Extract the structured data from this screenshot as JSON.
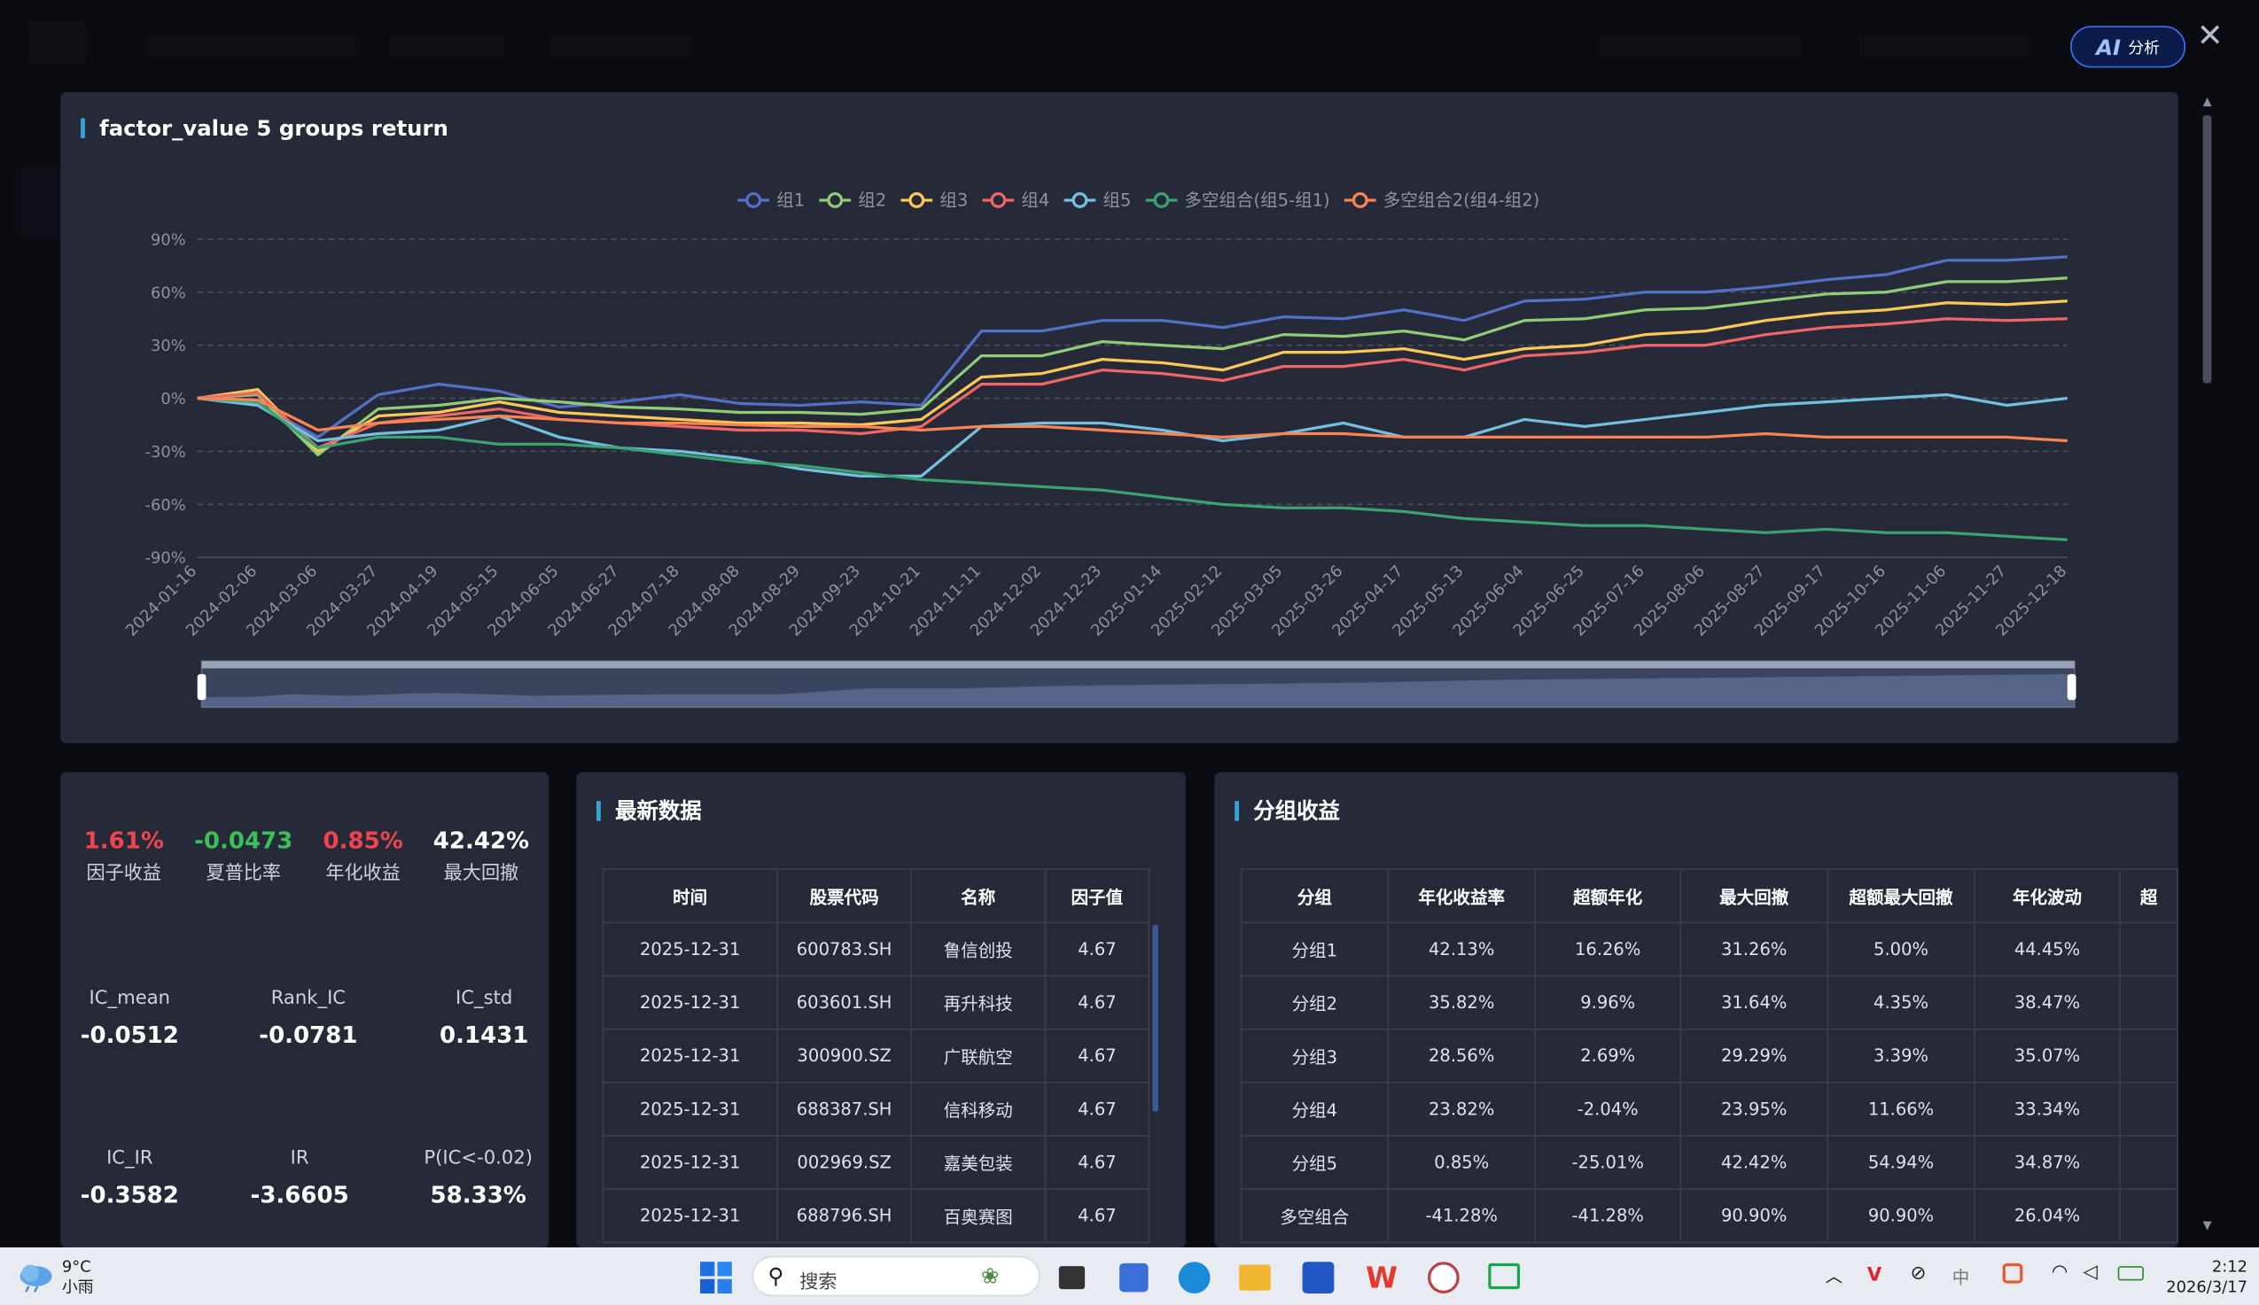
{
  "header": {
    "ai_label": "AI",
    "ai_text": "分析"
  },
  "chart_panel_title": "factor_value 5 groups return",
  "chart_data": {
    "type": "line",
    "title": "factor_value 5 groups return",
    "ylim": [
      -90,
      90
    ],
    "yticks": [
      "90%",
      "60%",
      "30%",
      "0%",
      "-30%",
      "-60%",
      "-90%"
    ],
    "grid": true,
    "legend_position": "top-center",
    "x_labels": [
      "2024-01-16",
      "2024-02-06",
      "2024-03-06",
      "2024-03-27",
      "2024-04-19",
      "2024-05-15",
      "2024-06-05",
      "2024-06-27",
      "2024-07-18",
      "2024-08-08",
      "2024-08-29",
      "2024-09-23",
      "2024-10-21",
      "2024-11-11",
      "2024-12-02",
      "2024-12-23",
      "2025-01-14",
      "2025-02-12",
      "2025-03-05",
      "2025-03-26",
      "2025-04-17",
      "2025-05-13",
      "2025-06-04",
      "2025-06-25",
      "2025-07-16",
      "2025-08-06",
      "2025-08-27",
      "2025-09-17",
      "2025-10-16",
      "2025-11-06",
      "2025-11-27",
      "2025-12-18"
    ],
    "series": [
      {
        "name": "组1",
        "color": "#5470c6",
        "values": [
          0,
          -3,
          -22,
          2,
          8,
          4,
          -5,
          -2,
          2,
          -3,
          -4,
          -2,
          -4,
          38,
          38,
          44,
          44,
          40,
          46,
          45,
          50,
          44,
          55,
          56,
          60,
          60,
          63,
          67,
          70,
          78,
          78,
          80
        ]
      },
      {
        "name": "组2",
        "color": "#91cc75",
        "values": [
          0,
          2,
          -32,
          -6,
          -4,
          0,
          -2,
          -5,
          -6,
          -8,
          -8,
          -9,
          -6,
          24,
          24,
          32,
          30,
          28,
          36,
          35,
          38,
          33,
          44,
          45,
          50,
          51,
          55,
          59,
          60,
          66,
          66,
          68
        ]
      },
      {
        "name": "组3",
        "color": "#fac858",
        "values": [
          0,
          5,
          -30,
          -10,
          -8,
          -2,
          -8,
          -10,
          -12,
          -14,
          -14,
          -15,
          -12,
          12,
          14,
          22,
          20,
          16,
          26,
          26,
          28,
          22,
          28,
          30,
          36,
          38,
          44,
          48,
          50,
          54,
          53,
          55
        ]
      },
      {
        "name": "组4",
        "color": "#ee6666",
        "values": [
          0,
          3,
          -28,
          -14,
          -10,
          -6,
          -12,
          -14,
          -16,
          -18,
          -18,
          -20,
          -16,
          8,
          8,
          16,
          14,
          10,
          18,
          18,
          22,
          16,
          24,
          26,
          30,
          30,
          36,
          40,
          42,
          45,
          44,
          45
        ]
      },
      {
        "name": "组5",
        "color": "#73c0de",
        "values": [
          0,
          -4,
          -24,
          -20,
          -18,
          -10,
          -22,
          -28,
          -30,
          -34,
          -40,
          -44,
          -44,
          -16,
          -14,
          -14,
          -18,
          -24,
          -20,
          -14,
          -22,
          -22,
          -12,
          -16,
          -12,
          -8,
          -4,
          -2,
          0,
          2,
          -4,
          0
        ]
      },
      {
        "name": "多空组合(组5-组1)",
        "color": "#3ba272",
        "values": [
          0,
          -2,
          -28,
          -22,
          -22,
          -26,
          -26,
          -28,
          -32,
          -36,
          -38,
          -42,
          -46,
          -48,
          -50,
          -52,
          -56,
          -60,
          -62,
          -62,
          -64,
          -68,
          -70,
          -72,
          -72,
          -74,
          -76,
          -74,
          -76,
          -76,
          -78,
          -80
        ]
      },
      {
        "name": "多空组合2(组4-组2)",
        "color": "#fc8452",
        "values": [
          0,
          -1,
          -18,
          -14,
          -12,
          -10,
          -12,
          -14,
          -14,
          -15,
          -16,
          -16,
          -18,
          -16,
          -16,
          -18,
          -20,
          -22,
          -20,
          -20,
          -22,
          -22,
          -22,
          -22,
          -22,
          -22,
          -20,
          -22,
          -22,
          -22,
          -22,
          -24
        ]
      }
    ]
  },
  "metrics": {
    "factor_return": {
      "value": "1.61%",
      "label": "因子收益"
    },
    "sharpe": {
      "value": "-0.0473",
      "label": "夏普比率"
    },
    "annual_return": {
      "value": "0.85%",
      "label": "年化收益"
    },
    "max_drawdown": {
      "value": "42.42%",
      "label": "最大回撤"
    },
    "ic_mean": {
      "value": "-0.0512",
      "label": "IC_mean"
    },
    "rank_ic": {
      "value": "-0.0781",
      "label": "Rank_IC"
    },
    "ic_std": {
      "value": "0.1431",
      "label": "IC_std"
    },
    "ic_ir": {
      "value": "-0.3582",
      "label": "IC_IR"
    },
    "ir": {
      "value": "-3.6605",
      "label": "IR"
    },
    "p_ic": {
      "value": "58.33%",
      "label": "P(IC<-0.02)"
    }
  },
  "latest": {
    "title": "最新数据",
    "columns": [
      "时间",
      "股票代码",
      "名称",
      "因子值"
    ],
    "rows": [
      [
        "2025-12-31",
        "600783.SH",
        "鲁信创投",
        "4.67"
      ],
      [
        "2025-12-31",
        "603601.SH",
        "再升科技",
        "4.67"
      ],
      [
        "2025-12-31",
        "300900.SZ",
        "广联航空",
        "4.67"
      ],
      [
        "2025-12-31",
        "688387.SH",
        "信科移动",
        "4.67"
      ],
      [
        "2025-12-31",
        "002969.SZ",
        "嘉美包装",
        "4.67"
      ],
      [
        "2025-12-31",
        "688796.SH",
        "百奥赛图",
        "4.67"
      ]
    ]
  },
  "groups": {
    "title": "分组收益",
    "columns": [
      "分组",
      "年化收益率",
      "超额年化",
      "最大回撤",
      "超额最大回撤",
      "年化波动",
      "超"
    ],
    "rows": [
      [
        "分组1",
        "42.13%",
        "16.26%",
        "31.26%",
        "5.00%",
        "44.45%",
        ""
      ],
      [
        "分组2",
        "35.82%",
        "9.96%",
        "31.64%",
        "4.35%",
        "38.47%",
        ""
      ],
      [
        "分组3",
        "28.56%",
        "2.69%",
        "29.29%",
        "3.39%",
        "35.07%",
        ""
      ],
      [
        "分组4",
        "23.82%",
        "-2.04%",
        "23.95%",
        "11.66%",
        "33.34%",
        ""
      ],
      [
        "分组5",
        "0.85%",
        "-25.01%",
        "42.42%",
        "54.94%",
        "34.87%",
        ""
      ],
      [
        "多空组合",
        "-41.28%",
        "-41.28%",
        "90.90%",
        "90.90%",
        "26.04%",
        ""
      ]
    ]
  },
  "taskbar": {
    "weather_temp": "9°C",
    "weather_desc": "小雨",
    "search_placeholder": "搜索",
    "ime": "中",
    "time": "2:12",
    "date": "2026/3/17"
  },
  "colors": {
    "positive": "#f0444f",
    "negative": "#39c05a",
    "accent": "#34a3d8",
    "panel": "#262a38"
  }
}
